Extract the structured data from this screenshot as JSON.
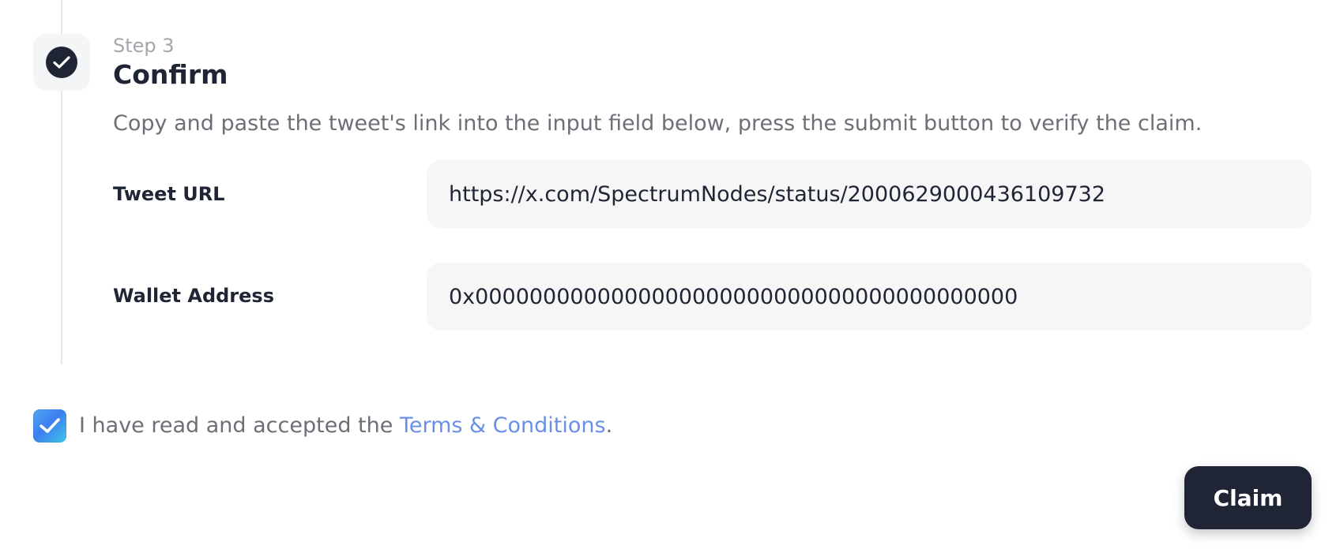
{
  "step": {
    "label": "Step 3",
    "title": "Confirm",
    "description": "Copy and paste the tweet's link into the input field below, press the submit button to verify the claim.",
    "status_icon": "check-icon"
  },
  "form": {
    "tweet_url": {
      "label": "Tweet URL",
      "value": "https://x.com/SpectrumNodes/status/2000629000436109732"
    },
    "wallet_address": {
      "label": "Wallet Address",
      "value": "0x0000000000000000000000000000000000000000"
    }
  },
  "terms": {
    "checked": true,
    "text_before": "I have read and accepted the ",
    "link_text": "Terms & Conditions",
    "text_after": "."
  },
  "actions": {
    "claim_label": "Claim"
  },
  "colors": {
    "primary_dark": "#1f2535",
    "link": "#6a8fe9",
    "input_bg": "#f6f6f6",
    "muted_text": "#6b6f76"
  }
}
